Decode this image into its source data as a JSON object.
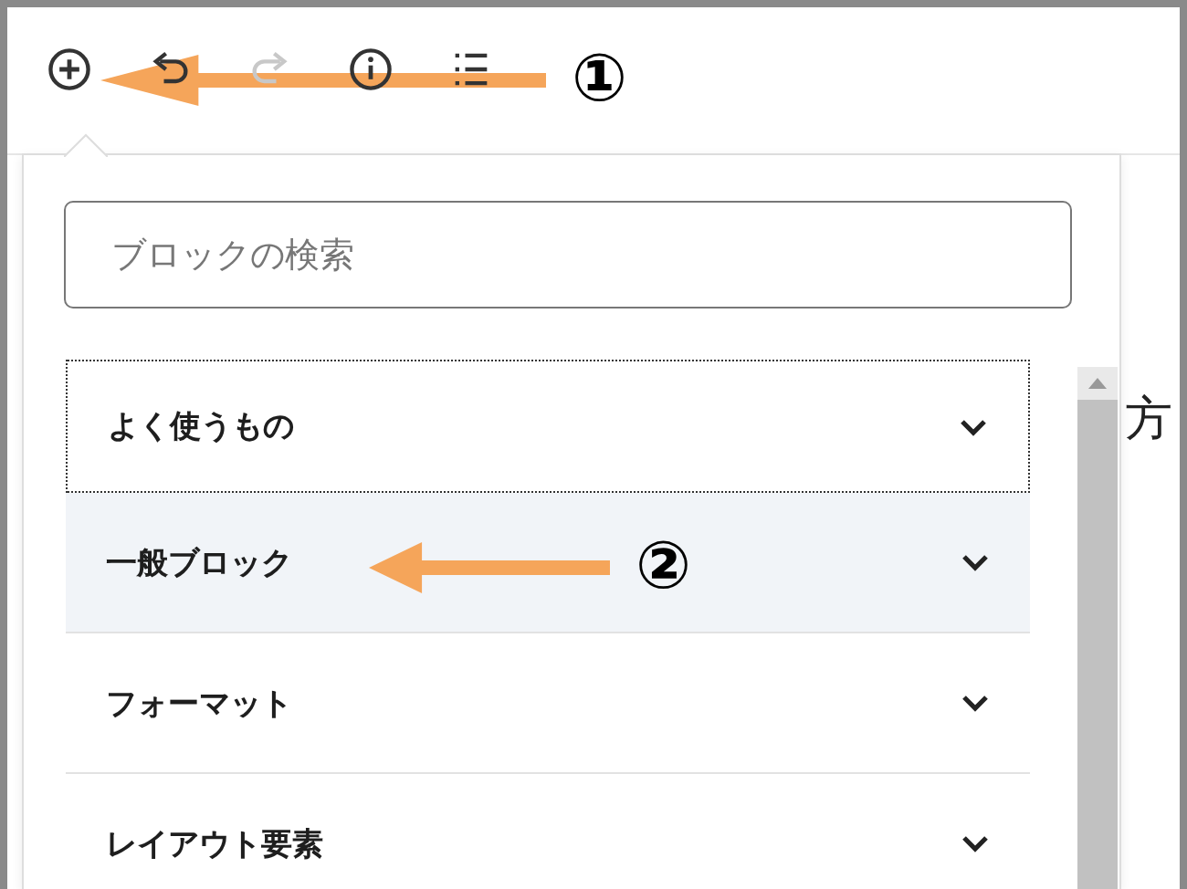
{
  "toolbar": [
    {
      "kind": "add",
      "disabled": false
    },
    {
      "kind": "undo",
      "disabled": false
    },
    {
      "kind": "redo",
      "disabled": true
    },
    {
      "kind": "info",
      "disabled": false
    },
    {
      "kind": "outline",
      "disabled": false
    }
  ],
  "search": {
    "placeholder": "ブロックの検索"
  },
  "categories": [
    {
      "label": "よく使うもの",
      "focused": true,
      "hovered": false
    },
    {
      "label": "一般ブロック",
      "focused": false,
      "hovered": true
    },
    {
      "label": "フォーマット",
      "focused": false,
      "hovered": false
    },
    {
      "label": "レイアウト要素",
      "focused": false,
      "hovered": false
    }
  ],
  "editor_text": "方",
  "annotations": [
    {
      "label": "①",
      "kind": "long"
    },
    {
      "label": "②",
      "kind": "short"
    }
  ]
}
